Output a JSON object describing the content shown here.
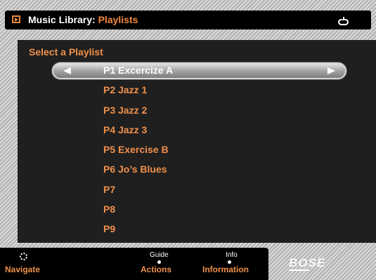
{
  "header": {
    "title": "Music Library:",
    "subtitle": "Playlists"
  },
  "list": {
    "heading": "Select a Playlist",
    "selected_index": 0,
    "items": [
      "P1 Excercize A",
      "P2 Jazz 1",
      "P3 Jazz 2",
      "P4 Jazz 3",
      "P5 Exercise B",
      "P6 Jo’s Blues",
      "P7",
      "P8",
      "P9"
    ]
  },
  "footer": {
    "navigate_label": "Navigate",
    "guide_hint": "Guide",
    "actions_label": "Actions",
    "info_hint": "Info",
    "information_label": "Information"
  },
  "brand": "BOSE",
  "icons": {
    "title": "play-box-icon",
    "power": "power-icon",
    "navigate": "dpad-icon",
    "selector_left": "arrow-left-icon",
    "selector_right": "arrow-right-icon"
  },
  "colors": {
    "accent": "#f0904a",
    "panel": "#1f1f1f",
    "bar": "#000000",
    "text": "#ffffff"
  }
}
